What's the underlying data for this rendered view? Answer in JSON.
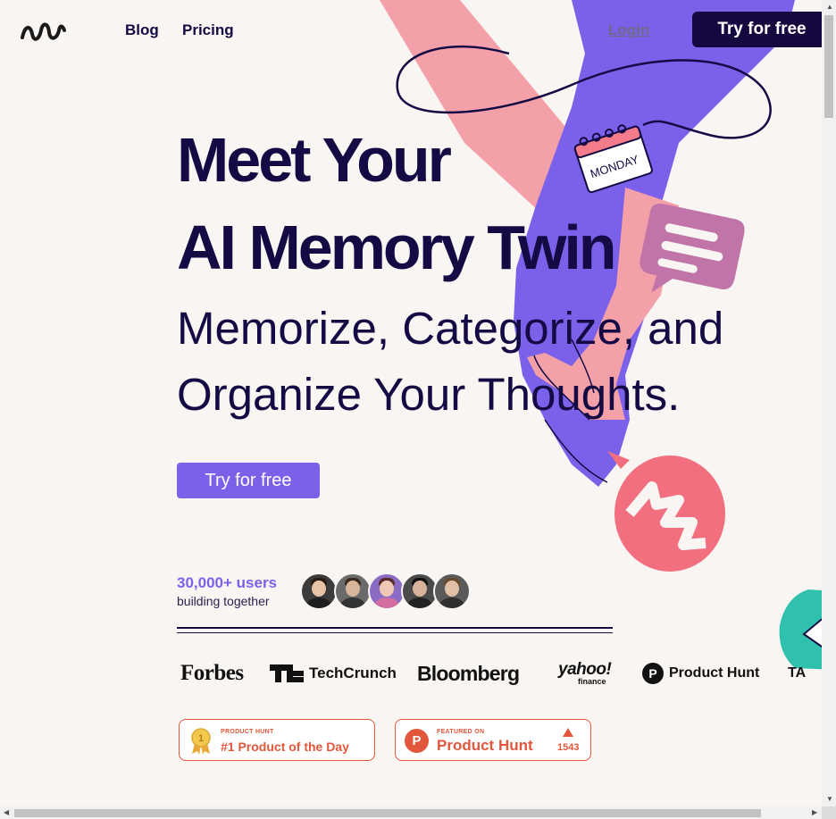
{
  "header": {
    "nav": {
      "blog": "Blog",
      "pricing": "Pricing",
      "login": "Login"
    },
    "cta_label": "Try for free"
  },
  "hero": {
    "title_line1": "Meet Your",
    "title_line2": "AI Memory Twin",
    "subtitle_line1": "Memorize, Categorize, and",
    "subtitle_line2": "Organize Your Thoughts.",
    "cta_label": "Try for free"
  },
  "art": {
    "calendar_text": "MONDAY"
  },
  "social_proof": {
    "users_count": "30,000+ users",
    "users_caption": "building together"
  },
  "press": {
    "forbes": "Forbes",
    "techcrunch": "TechCrunch",
    "bloomberg": "Bloomberg",
    "yahoo_top": "yahoo!",
    "yahoo_bottom": "finance",
    "producthunt": "Product Hunt",
    "producthunt_mark": "P",
    "partial": "TA"
  },
  "badges": {
    "day": {
      "small": "PRODUCT HUNT",
      "big": "#1 Product of the Day",
      "medal_number": "1"
    },
    "featured": {
      "small": "FEATURED ON",
      "big": "Product Hunt",
      "mark": "P",
      "votes": "1543"
    }
  },
  "colors": {
    "navy": "#140a44",
    "purple": "#7b61ea",
    "pink": "#f4a0a8",
    "coral": "#e2573b",
    "teal": "#2fc1ad",
    "background": "#f8f5f2"
  }
}
